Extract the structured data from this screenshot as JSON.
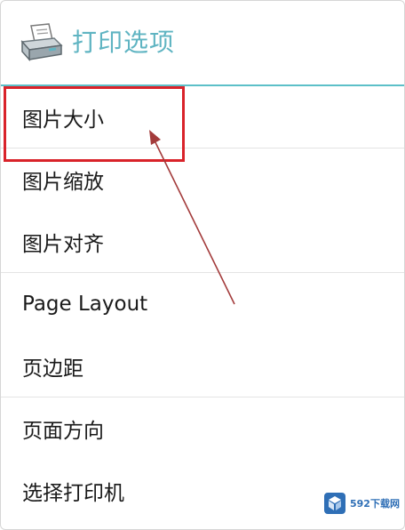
{
  "dialog": {
    "title": "打印选项",
    "icon": "printer-icon",
    "accent_color": "#5cc0c8"
  },
  "menu": {
    "items": [
      {
        "label": "图片大小",
        "divider": true
      },
      {
        "label": "图片缩放",
        "divider": false
      },
      {
        "label": "图片对齐",
        "divider": true
      },
      {
        "label": "Page Layout",
        "divider": false
      },
      {
        "label": "页边距",
        "divider": true
      },
      {
        "label": "页面方向",
        "divider": false
      },
      {
        "label": "选择打印机",
        "divider": false
      }
    ]
  },
  "annotation": {
    "highlight_color": "#d9232a",
    "arrow_color": "#a33b3b"
  },
  "watermark": {
    "text": "592下载网"
  }
}
